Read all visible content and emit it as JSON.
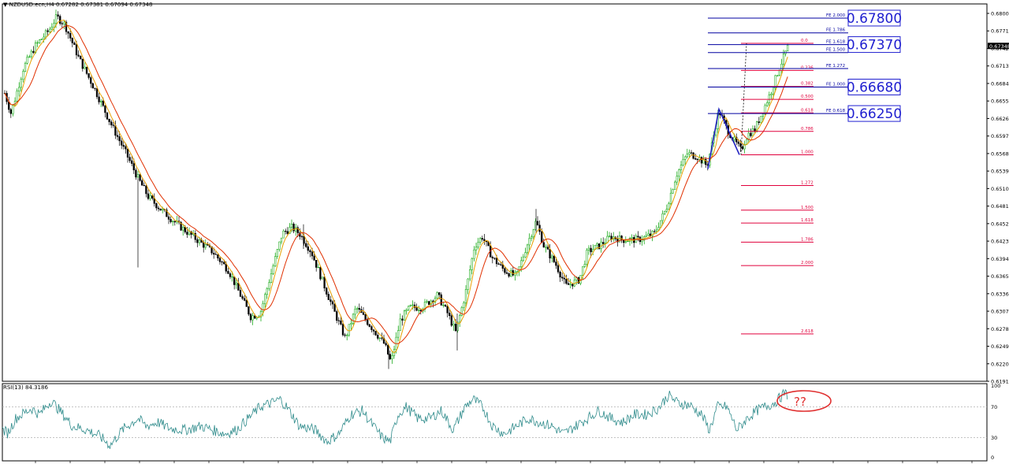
{
  "window": {
    "symbol_line": "NZDUSD.ecn,H4  0.67282 0.67381 0.67094 0.67348",
    "rsi_label": "RSI(13) 84.3186"
  },
  "price_axis": {
    "min": 0.619,
    "max": 0.6803,
    "labels": [
      "0.68000",
      "0.67710",
      "0.67420",
      "0.67130",
      "0.66840",
      "0.66550",
      "0.66260",
      "0.65970",
      "0.65680",
      "0.65390",
      "0.65100",
      "0.64810",
      "0.64520",
      "0.64230",
      "0.63940",
      "0.63650",
      "0.63360",
      "0.63070",
      "0.62780",
      "0.62490",
      "0.62200",
      "0.61910"
    ],
    "current_price": "0.67348"
  },
  "rsi_axis": {
    "labels": [
      "100",
      "70",
      "30",
      "0"
    ],
    "levels": [
      70,
      30
    ]
  },
  "fib_retracement": [
    {
      "label": "0.0",
      "price": 0.6739
    },
    {
      "label": "0.236",
      "price": 0.6695
    },
    {
      "label": "0.382",
      "price": 0.6669
    },
    {
      "label": "0.500",
      "price": 0.6648
    },
    {
      "label": "0.618",
      "price": 0.6626
    },
    {
      "label": "0.786",
      "price": 0.6596
    },
    {
      "label": "1.000",
      "price": 0.6558
    },
    {
      "label": "1.272",
      "price": 0.6508
    },
    {
      "label": "1.500",
      "price": 0.6468
    },
    {
      "label": "1.618",
      "price": 0.6447
    },
    {
      "label": "1.786",
      "price": 0.6416
    },
    {
      "label": "2.000",
      "price": 0.6378
    },
    {
      "label": "2.618",
      "price": 0.6267
    }
  ],
  "fib_expansion": [
    {
      "label": "FE 2.000",
      "price": 0.678
    },
    {
      "label": "FE 1.786",
      "price": 0.6756
    },
    {
      "label": "FE 1.618",
      "price": 0.6737
    },
    {
      "label": "FE 1.500",
      "price": 0.6724
    },
    {
      "label": "FE 1.272",
      "price": 0.6698
    },
    {
      "label": "FE 1.000",
      "price": 0.6668
    },
    {
      "label": "FE 0.618",
      "price": 0.6625
    }
  ],
  "target_boxes": [
    {
      "text": "0.67800",
      "price": 0.678
    },
    {
      "text": "0.67370",
      "price": 0.6737
    },
    {
      "text": "0.66680",
      "price": 0.6668
    },
    {
      "text": "0.66250",
      "price": 0.6625
    }
  ],
  "rsi_annotation": "??",
  "colors": {
    "bull_candle": "#00a000",
    "bear_candle": "#000000",
    "ma_fast": "#e8a000",
    "ma_slow": "#e03000",
    "fib_retracement": "#e0003c",
    "fib_expansion": "#0000a0",
    "target_box": "#2020d0",
    "rsi_line": "#2e8b8b",
    "annotation": "#e03030"
  }
}
